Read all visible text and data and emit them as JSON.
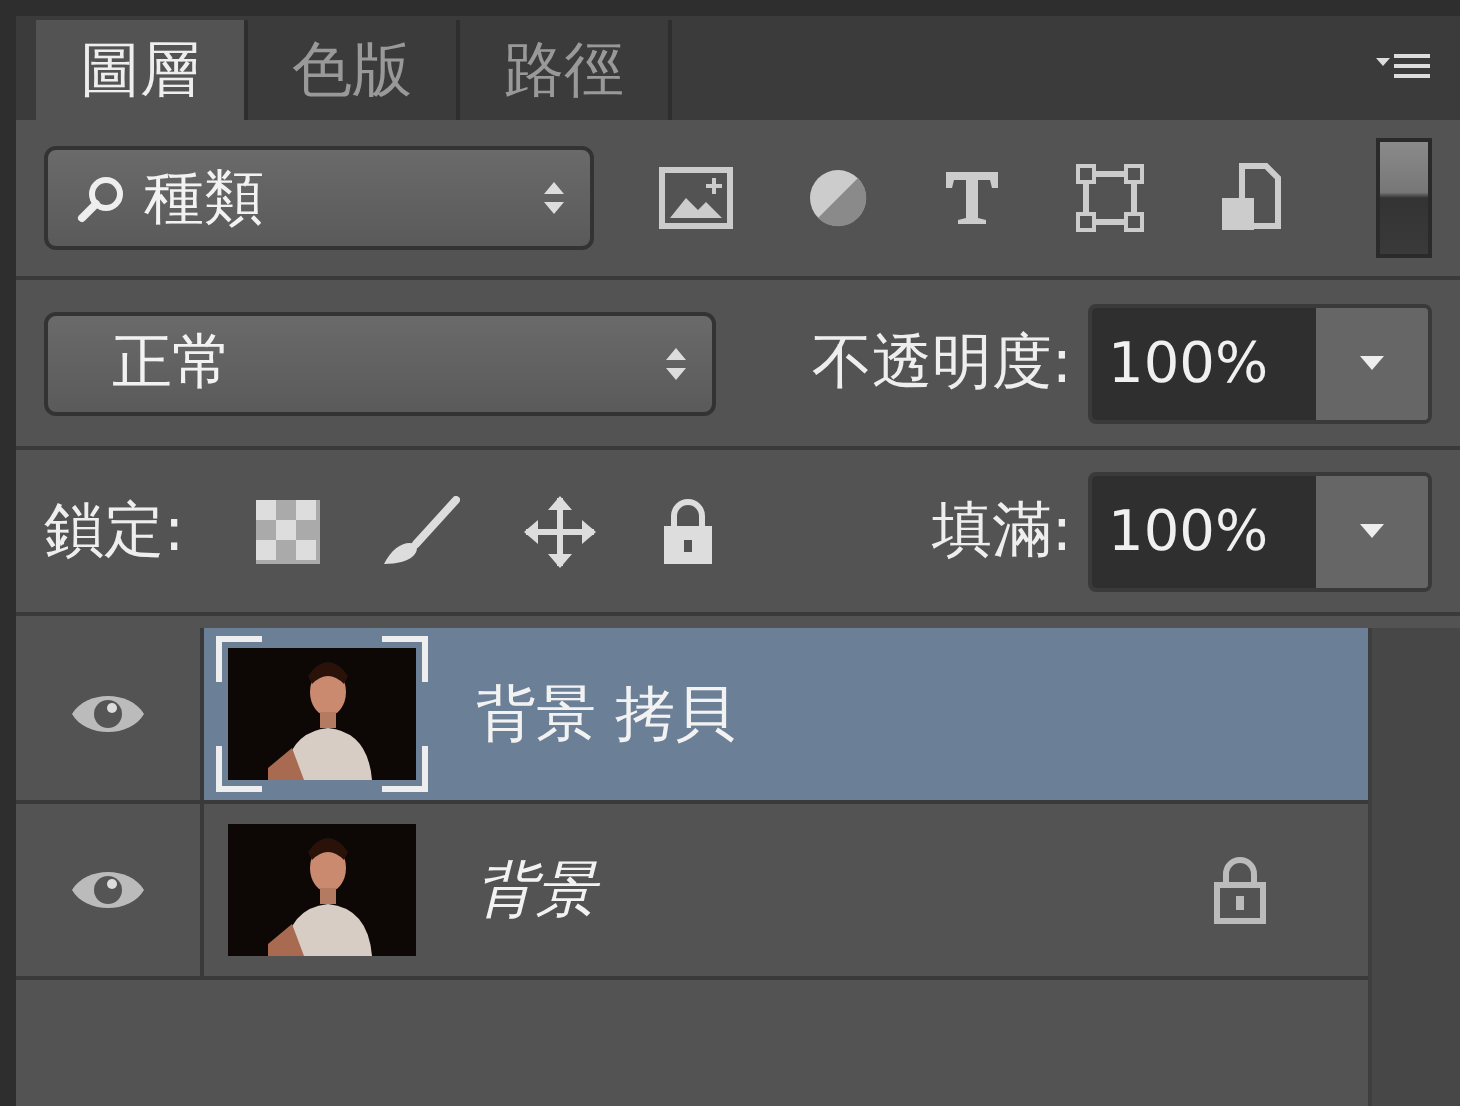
{
  "tabs": [
    {
      "label": "圖層",
      "selected": true
    },
    {
      "label": "色版",
      "selected": false
    },
    {
      "label": "路徑",
      "selected": false
    }
  ],
  "filter": {
    "value": "種類"
  },
  "blend_mode": {
    "value": "正常"
  },
  "opacity": {
    "label": "不透明度:",
    "value": "100%"
  },
  "lock": {
    "label": "鎖定:"
  },
  "fill": {
    "label": "填滿:",
    "value": "100%"
  },
  "layers": [
    {
      "name": "背景 拷貝",
      "kind": "normal",
      "visible": true,
      "selected": true,
      "locked": false
    },
    {
      "name": "背景",
      "kind": "background",
      "visible": true,
      "selected": false,
      "locked": true
    }
  ]
}
